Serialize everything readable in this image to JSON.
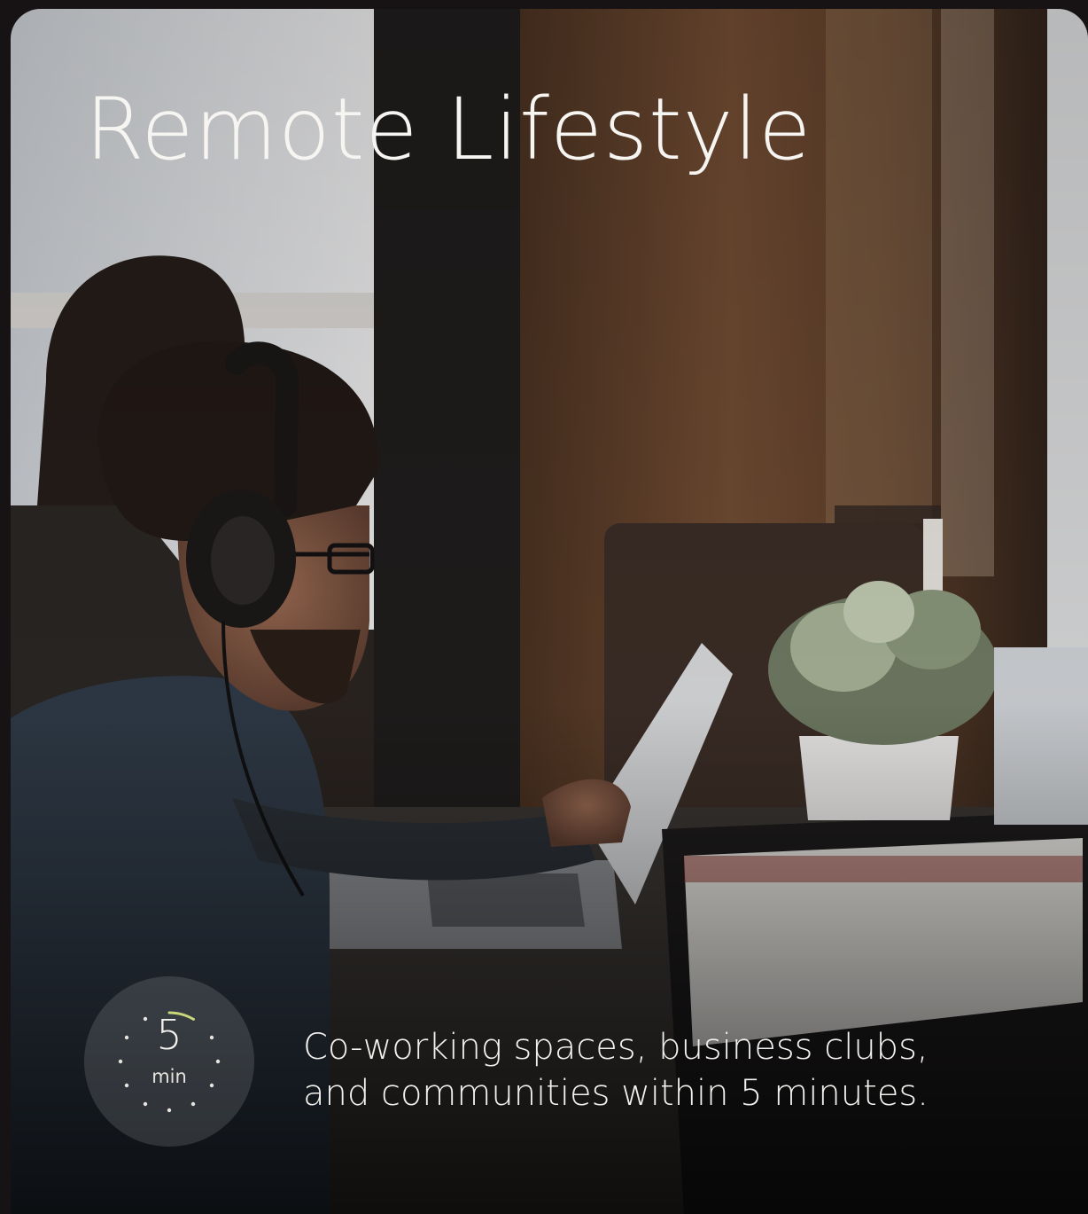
{
  "card": {
    "title": "Remote Lifestyle",
    "photo": "man-with-headphones-working-on-laptop",
    "timer": {
      "value": "5",
      "unit": "min",
      "icon": "clock-dial-icon",
      "accent_color": "#c9d77a"
    },
    "description": {
      "line1": "Co-working spaces, business clubs,",
      "line2": "and communities within 5 minutes."
    }
  }
}
